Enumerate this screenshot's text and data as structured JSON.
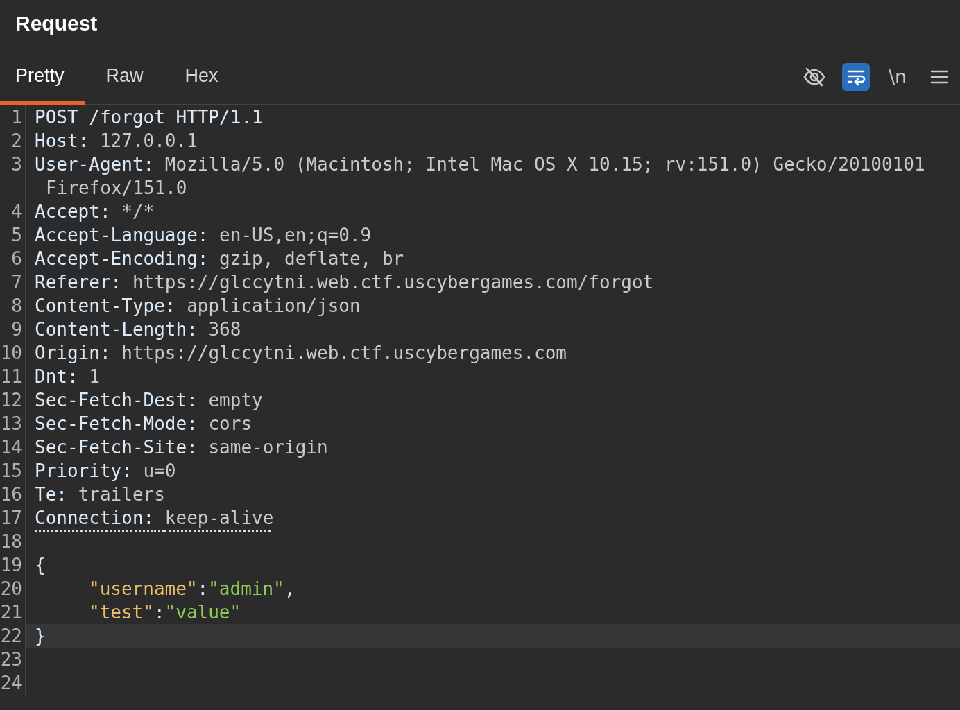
{
  "panel": {
    "title": "Request"
  },
  "tabs": [
    {
      "label": "Pretty",
      "selected": true
    },
    {
      "label": "Raw",
      "selected": false
    },
    {
      "label": "Hex",
      "selected": false
    }
  ],
  "toolbar": [
    {
      "kind": "hide",
      "selected": false
    },
    {
      "kind": "wrap",
      "selected": true
    },
    {
      "kind": "text",
      "label": "\\n",
      "selected": false
    },
    {
      "kind": "menu",
      "selected": false
    }
  ],
  "lines": [
    {
      "number": "1",
      "kind": "plain",
      "current": false,
      "flagged": false,
      "text": "POST /forgot HTTP/1.1"
    },
    {
      "number": "2",
      "kind": "header",
      "current": false,
      "flagged": false,
      "name": "Host:",
      "value": "127.0.0.1"
    },
    {
      "number": "3",
      "kind": "header",
      "current": false,
      "flagged": false,
      "name": "User-Agent:",
      "value": "Mozilla/5.0 (Macintosh; Intel Mac OS X 10.15; rv:151.0) Gecko/20100101 Firefox/151.0"
    },
    {
      "number": "4",
      "kind": "header",
      "current": false,
      "flagged": false,
      "name": "Accept:",
      "value": "*/*"
    },
    {
      "number": "5",
      "kind": "header",
      "current": false,
      "flagged": false,
      "name": "Accept-Language:",
      "value": "en-US,en;q=0.9"
    },
    {
      "number": "6",
      "kind": "header",
      "current": false,
      "flagged": false,
      "name": "Accept-Encoding:",
      "value": "gzip, deflate, br"
    },
    {
      "number": "7",
      "kind": "header",
      "current": false,
      "flagged": false,
      "name": "Referer:",
      "value": "https://glccytni.web.ctf.uscybergames.com/forgot"
    },
    {
      "number": "8",
      "kind": "header",
      "current": false,
      "flagged": false,
      "name": "Content-Type:",
      "value": "application/json"
    },
    {
      "number": "9",
      "kind": "header",
      "current": false,
      "flagged": false,
      "name": "Content-Length:",
      "value": "368"
    },
    {
      "number": "10",
      "kind": "header",
      "current": false,
      "flagged": false,
      "name": "Origin:",
      "value": "https://glccytni.web.ctf.uscybergames.com"
    },
    {
      "number": "11",
      "kind": "header",
      "current": false,
      "flagged": false,
      "name": "Dnt:",
      "value": "1"
    },
    {
      "number": "12",
      "kind": "header",
      "current": false,
      "flagged": false,
      "name": "Sec-Fetch-Dest:",
      "value": "empty"
    },
    {
      "number": "13",
      "kind": "header",
      "current": false,
      "flagged": false,
      "name": "Sec-Fetch-Mode:",
      "value": "cors"
    },
    {
      "number": "14",
      "kind": "header",
      "current": false,
      "flagged": false,
      "name": "Sec-Fetch-Site:",
      "value": "same-origin"
    },
    {
      "number": "15",
      "kind": "header",
      "current": false,
      "flagged": false,
      "name": "Priority:",
      "value": "u=0"
    },
    {
      "number": "16",
      "kind": "header",
      "current": false,
      "flagged": false,
      "name": "Te:",
      "value": "trailers"
    },
    {
      "number": "17",
      "kind": "header",
      "current": false,
      "flagged": true,
      "name": "Connection:",
      "value": "keep-alive"
    },
    {
      "number": "18",
      "kind": "blank",
      "current": false,
      "flagged": false
    },
    {
      "number": "19",
      "kind": "plain",
      "current": false,
      "flagged": false,
      "text": "{"
    },
    {
      "number": "20",
      "kind": "pair",
      "current": false,
      "flagged": false,
      "key": "\"username\"",
      "colon": ":",
      "value": "\"admin\"",
      "comma": ","
    },
    {
      "number": "21",
      "kind": "pair",
      "current": false,
      "flagged": false,
      "key": "\"test\"",
      "colon": ":",
      "value": "\"value\""
    },
    {
      "number": "22",
      "kind": "plain",
      "current": true,
      "flagged": false,
      "text": "}"
    },
    {
      "number": "23",
      "kind": "blank",
      "current": false,
      "flagged": false
    },
    {
      "number": "24",
      "kind": "blank",
      "current": false,
      "flagged": false
    }
  ]
}
